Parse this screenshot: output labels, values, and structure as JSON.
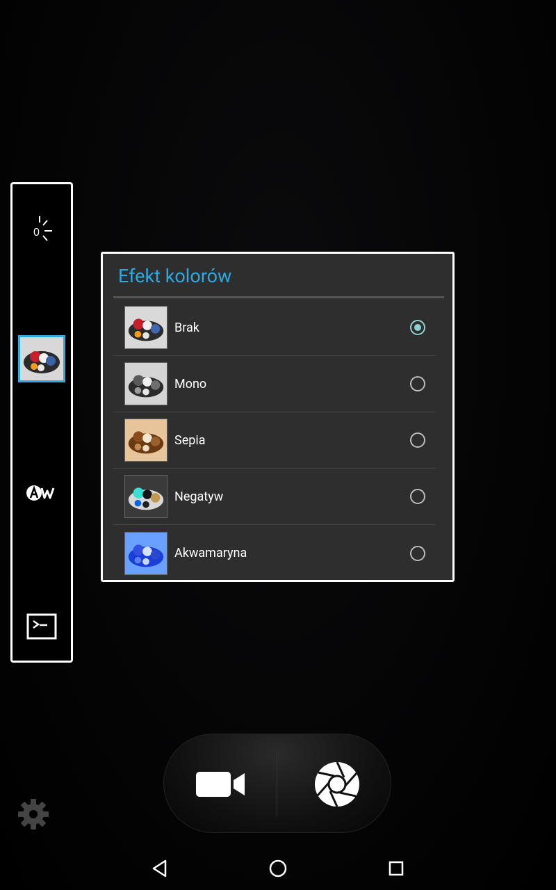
{
  "dialog": {
    "title": "Efekt kolorów",
    "options": [
      {
        "label": "Brak",
        "selected": true,
        "preview": "original"
      },
      {
        "label": "Mono",
        "selected": false,
        "preview": "mono"
      },
      {
        "label": "Sepia",
        "selected": false,
        "preview": "sepia"
      },
      {
        "label": "Negatyw",
        "selected": false,
        "preview": "negative"
      },
      {
        "label": "Akwamaryna",
        "selected": false,
        "preview": "aqua"
      }
    ]
  },
  "side_panel": {
    "exposure_value": "0",
    "icons": [
      "exposure-icon",
      "color-effect-thumbnail",
      "white-balance-auto-icon",
      "scene-mode-icon"
    ]
  },
  "colors": {
    "accent": "#2fa8e0",
    "radio_checked": "#8fd0d0",
    "dialog_bg": "#2e2e2e"
  },
  "nav": {
    "icons": [
      "back-icon",
      "home-icon",
      "recents-icon"
    ]
  }
}
